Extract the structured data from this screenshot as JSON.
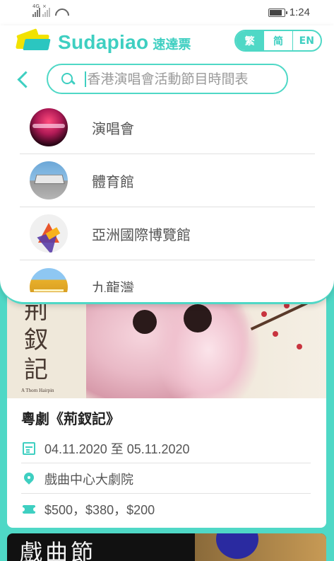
{
  "status_bar": {
    "signal_tag_1": "4G",
    "signal_tag_2": "×",
    "time": "1:24"
  },
  "header": {
    "brand_name": "Sudapiao",
    "brand_cn": "速達票",
    "languages": [
      {
        "label": "繁",
        "active": true
      },
      {
        "label": "简",
        "active": false
      },
      {
        "label": "EN",
        "active": false
      }
    ]
  },
  "search": {
    "placeholder": "香港演唱會活動節目時間表",
    "value": ""
  },
  "suggestions": [
    {
      "label": "演唱會",
      "icon": "concert-thumbnail"
    },
    {
      "label": "體育館",
      "icon": "coliseum-thumbnail"
    },
    {
      "label": "亞洲國際博覽館",
      "icon": "asiaworld-expo-logo"
    },
    {
      "label": "九龍灣",
      "icon": "kowloon-bay-thumbnail"
    }
  ],
  "event": {
    "poster_title": "荆釵記",
    "poster_subtitle": "A Thorn Hairpin",
    "name": "粵劇《荊釵記》",
    "date": "04.11.2020 至 05.11.2020",
    "venue": "戲曲中心大劇院",
    "price": "$500，$380，$200"
  },
  "next_event": {
    "poster_title": "戲曲節"
  },
  "colors": {
    "accent": "#4fd8c6",
    "brand_yellow": "#f2e200"
  }
}
